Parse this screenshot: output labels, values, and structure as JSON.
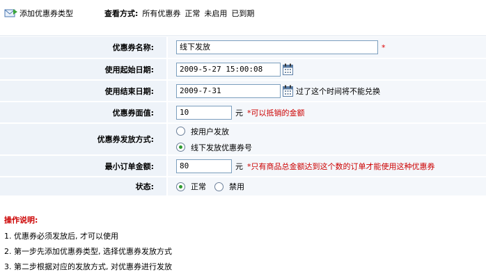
{
  "toolbar": {
    "add_label": "添加优惠券类型",
    "view_mode_label": "查看方式:",
    "view_options": [
      "所有优惠券",
      "正常",
      "未启用",
      "已到期"
    ]
  },
  "form": {
    "name": {
      "label": "优惠券名称:",
      "value": "线下发放",
      "required_mark": "*"
    },
    "start_date": {
      "label": "使用起始日期:",
      "value": "2009-5-27 15:00:08"
    },
    "end_date": {
      "label": "使用结束日期:",
      "value": "2009-7-31",
      "note": "过了这个时间将不能兑换"
    },
    "face_value": {
      "label": "优惠券面值:",
      "value": "10",
      "unit": "元",
      "note": "*可以抵销的金额"
    },
    "issue_method": {
      "label": "优惠券发放方式:",
      "options": [
        "按用户发放",
        "线下发放优惠券号"
      ],
      "selected": "线下发放优惠券号"
    },
    "min_order": {
      "label": "最小订单金额:",
      "value": "80",
      "unit": "元",
      "note": "*只有商品总金额达到这个数的订单才能使用这种优惠券"
    },
    "status": {
      "label": "状态:",
      "options": [
        "正常",
        "禁用"
      ],
      "selected": "正常"
    }
  },
  "help": {
    "title": "操作说明:",
    "items": [
      "1. 优惠券必须发放后, 才可以使用",
      "2. 第一步先添加优惠券类型, 选择优惠券发放方式",
      "3. 第二步根据对应的发放方式, 对优惠券进行发放"
    ]
  },
  "colors": {
    "label_bg": "#eef3f9",
    "field_bg": "#f4f7fb",
    "input_border": "#7b9ebd",
    "accent_red": "#cc0000",
    "radio_selected": "#2f9b2f"
  },
  "icons": {
    "add": "envelope-add-icon",
    "calendar": "calendar-icon"
  }
}
